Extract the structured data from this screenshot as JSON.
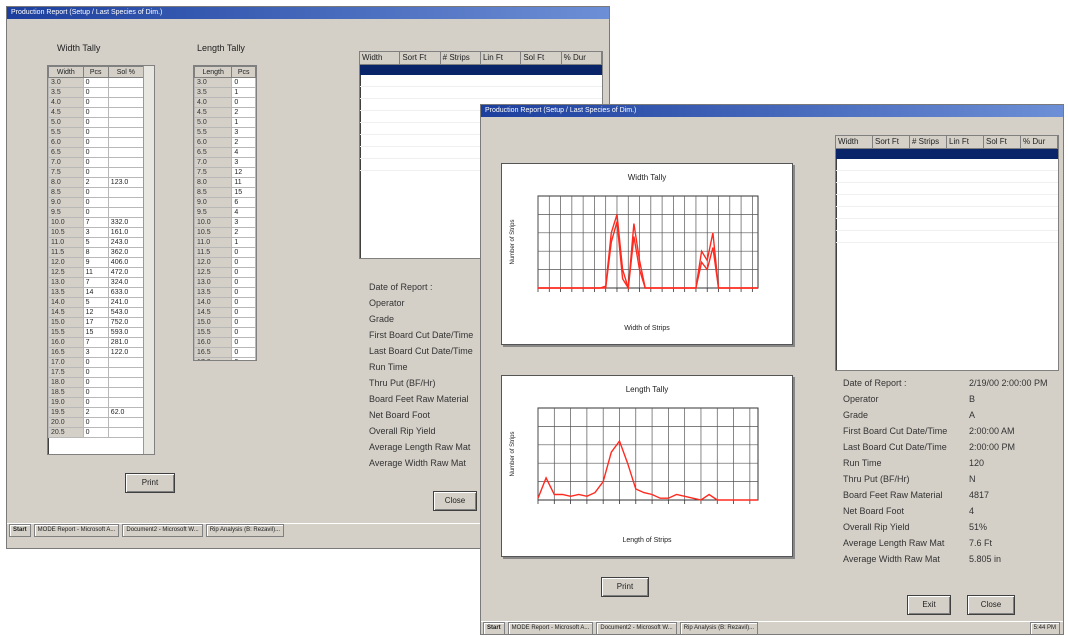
{
  "back": {
    "title": "Production Report  (Setup / Last Species of Dim.)",
    "width_tally": {
      "title": "Width Tally",
      "columns": [
        "Width",
        "Pcs",
        "Sol %"
      ],
      "rows": [
        [
          "3.0",
          "0",
          ""
        ],
        [
          "3.5",
          "0",
          ""
        ],
        [
          "4.0",
          "0",
          ""
        ],
        [
          "4.5",
          "0",
          ""
        ],
        [
          "5.0",
          "0",
          ""
        ],
        [
          "5.5",
          "0",
          ""
        ],
        [
          "6.0",
          "0",
          ""
        ],
        [
          "6.5",
          "0",
          ""
        ],
        [
          "7.0",
          "0",
          ""
        ],
        [
          "7.5",
          "0",
          ""
        ],
        [
          "8.0",
          "2",
          "123.0"
        ],
        [
          "8.5",
          "0",
          ""
        ],
        [
          "9.0",
          "0",
          ""
        ],
        [
          "9.5",
          "0",
          ""
        ],
        [
          "10.0",
          "7",
          "332.0"
        ],
        [
          "10.5",
          "3",
          "161.0"
        ],
        [
          "11.0",
          "5",
          "243.0"
        ],
        [
          "11.5",
          "8",
          "362.0"
        ],
        [
          "12.0",
          "9",
          "406.0"
        ],
        [
          "12.5",
          "11",
          "472.0"
        ],
        [
          "13.0",
          "7",
          "324.0"
        ],
        [
          "13.5",
          "14",
          "633.0"
        ],
        [
          "14.0",
          "5",
          "241.0"
        ],
        [
          "14.5",
          "12",
          "543.0"
        ],
        [
          "15.0",
          "17",
          "752.0"
        ],
        [
          "15.5",
          "15",
          "593.0"
        ],
        [
          "16.0",
          "7",
          "281.0"
        ],
        [
          "16.5",
          "3",
          "122.0"
        ],
        [
          "17.0",
          "0",
          ""
        ],
        [
          "17.5",
          "0",
          ""
        ],
        [
          "18.0",
          "0",
          ""
        ],
        [
          "18.5",
          "0",
          ""
        ],
        [
          "19.0",
          "0",
          ""
        ],
        [
          "19.5",
          "2",
          "62.0"
        ],
        [
          "20.0",
          "0",
          ""
        ],
        [
          "20.5",
          "0",
          ""
        ]
      ]
    },
    "length_tally": {
      "title": "Length Tally",
      "columns": [
        "Length",
        "Pcs"
      ],
      "rows": [
        [
          "3.0",
          "0"
        ],
        [
          "3.5",
          "1"
        ],
        [
          "4.0",
          "0"
        ],
        [
          "4.5",
          "2"
        ],
        [
          "5.0",
          "1"
        ],
        [
          "5.5",
          "3"
        ],
        [
          "6.0",
          "2"
        ],
        [
          "6.5",
          "4"
        ],
        [
          "7.0",
          "3"
        ],
        [
          "7.5",
          "12"
        ],
        [
          "8.0",
          "11"
        ],
        [
          "8.5",
          "15"
        ],
        [
          "9.0",
          "6"
        ],
        [
          "9.5",
          "4"
        ],
        [
          "10.0",
          "3"
        ],
        [
          "10.5",
          "2"
        ],
        [
          "11.0",
          "1"
        ],
        [
          "11.5",
          "0"
        ],
        [
          "12.0",
          "0"
        ],
        [
          "12.5",
          "0"
        ],
        [
          "13.0",
          "0"
        ],
        [
          "13.5",
          "0"
        ],
        [
          "14.0",
          "0"
        ],
        [
          "14.5",
          "0"
        ],
        [
          "15.0",
          "0"
        ],
        [
          "15.5",
          "0"
        ],
        [
          "16.0",
          "0"
        ],
        [
          "16.5",
          "0"
        ],
        [
          "17.0",
          "0"
        ]
      ]
    },
    "grid_columns": [
      "Width",
      "Sort Ft",
      "# Strips",
      "Lin Ft",
      "Sol Ft",
      "% Dur"
    ],
    "labels": [
      "Date of Report :",
      "Operator",
      "Grade",
      "First Board Cut Date/Time",
      "Last Board Cut Date/Time",
      "Run Time",
      "Thru Put (BF/Hr)",
      "Board Feet Raw Material",
      "Net Board Foot",
      "Overall Rip Yield",
      "Average Length Raw Mat",
      "Average Width Raw Mat"
    ],
    "print_button": "Print",
    "close_button": "Close",
    "taskbar": [
      "Start",
      "MODE Report - Microsoft A...",
      "Document2 - Microsoft W...",
      "Rip Analysis (B: Rezavil)..."
    ]
  },
  "front": {
    "title": "Production Report  (Setup / Last Species of Dim.)",
    "grid_columns": [
      "Width",
      "Sort Ft",
      "# Strips",
      "Lin Ft",
      "Sol Ft",
      "% Dur"
    ],
    "width_chart": {
      "title": "Width Tally",
      "xlabel": "Width of Strips",
      "ylabel": "Number of Strips"
    },
    "length_chart": {
      "title": "Length Tally",
      "xlabel": "Length of Strips",
      "ylabel": "Number of Strips"
    },
    "labels": [
      "Date of Report :",
      "Operator",
      "Grade",
      "First Board Cut Date/Time",
      "Last Board Cut Date/Time",
      "Run Time",
      "Thru Put (BF/Hr)",
      "Board Feet Raw Material",
      "Net Board Foot",
      "Overall Rip Yield",
      "Average Length Raw Mat",
      "Average Width Raw Mat"
    ],
    "values": [
      "2/19/00 2:00:00 PM",
      "B",
      "A",
      "2:00:00 AM",
      "2:00:00 PM",
      "120",
      "N",
      "4817",
      "4",
      "51%",
      "7.6 Ft",
      "5.805 in"
    ],
    "print_button": "Print",
    "exit_button": "Exit",
    "close_button": "Close",
    "taskbar": [
      "Start",
      "MODE Report - Microsoft A...",
      "Document2 - Microsoft W...",
      "Rip Analysis (B: Rezavil)..."
    ],
    "tray_time": "5:44 PM"
  },
  "chart_data": [
    {
      "type": "line",
      "title": "Width Tally",
      "xlabel": "Width of Strips",
      "ylabel": "Number of Strips",
      "x": [
        1,
        2,
        3,
        4,
        5,
        6,
        7,
        8,
        9,
        10,
        11,
        12,
        13,
        14,
        15,
        16,
        17,
        18,
        19,
        20,
        21,
        22,
        23,
        24,
        25,
        26,
        27,
        28,
        29,
        30,
        31,
        32,
        33,
        34,
        35,
        36,
        37,
        38,
        39,
        40
      ],
      "series": [
        {
          "values": [
            0,
            0,
            0,
            0,
            0,
            0,
            0,
            0,
            0,
            0,
            0,
            0,
            1,
            30,
            40,
            10,
            0,
            35,
            15,
            0,
            0,
            0,
            0,
            0,
            0,
            0,
            0,
            0,
            0,
            20,
            15,
            30,
            0,
            0,
            0,
            0,
            0,
            0,
            0,
            0
          ],
          "color": "#ff2a1f"
        },
        {
          "values": [
            0,
            0,
            0,
            0,
            0,
            0,
            0,
            0,
            0,
            0,
            0,
            0,
            0,
            25,
            36,
            5,
            0,
            28,
            10,
            0,
            0,
            0,
            0,
            0,
            0,
            0,
            0,
            0,
            0,
            14,
            10,
            22,
            0,
            0,
            0,
            0,
            0,
            0,
            0,
            0
          ],
          "color": "#ff2a1f"
        }
      ],
      "ylim": [
        0,
        50
      ],
      "grid": true,
      "color": "#ff2a1f"
    },
    {
      "type": "line",
      "title": "Length Tally",
      "xlabel": "Length of Strips",
      "ylabel": "Number of Strips",
      "x": [
        1,
        2,
        3,
        4,
        5,
        6,
        7,
        8,
        9,
        10,
        11,
        12,
        13,
        14,
        15,
        16,
        17,
        18,
        19,
        20,
        21,
        22,
        23,
        24,
        25,
        26,
        27,
        28
      ],
      "series": [
        {
          "values": [
            1,
            12,
            3,
            3,
            2,
            3,
            2,
            4,
            10,
            26,
            32,
            20,
            6,
            4,
            3,
            1,
            1,
            3,
            2,
            1,
            0,
            3,
            0,
            0,
            0,
            0,
            0,
            0
          ],
          "color": "#ff2a1f"
        }
      ],
      "ylim": [
        0,
        50
      ],
      "grid": true,
      "color": "#ff2a1f"
    }
  ]
}
